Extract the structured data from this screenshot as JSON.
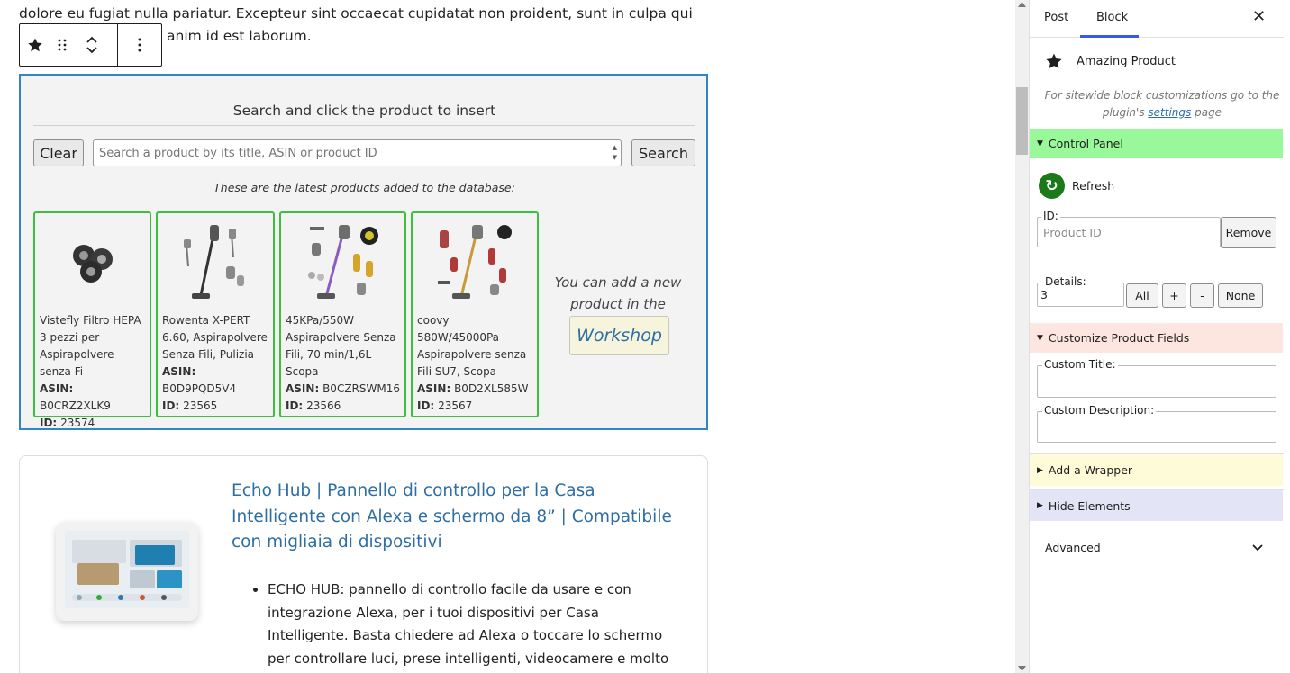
{
  "editor": {
    "paragraph_line1": "dolore eu fugiat nulla pariatur. Excepteur sint occaecat cupidatat non proident, sunt in culpa qui",
    "paragraph_line2": "anim id est laborum.",
    "block_box": {
      "title": "Search and click the product to insert",
      "clear_label": "Clear",
      "search_placeholder": "Search a product by its title, ASIN or product ID",
      "search_label": "Search",
      "latest_note": "These are the latest products added to the database:",
      "products": [
        {
          "title": "Vistefly Filtro HEPA 3 pezzi per Aspirapolvere senza Fi",
          "asin_label": "ASIN:",
          "asin": "B0CRZ2XLK9",
          "id_label": "ID:",
          "id": "23574",
          "image": "hepa-filters-icon"
        },
        {
          "title": "Rowenta X-PERT 6.60, Aspirapolvere Senza Fili, Pulizia",
          "asin_label": "ASIN:",
          "asin": "B0D9PQD5V4",
          "id_label": "ID:",
          "id": "23565",
          "image": "stick-vacuum-icon"
        },
        {
          "title": "45KPa/550W Aspirapolvere Senza Fili, 70 min/1,6L Scopa",
          "asin_label": "ASIN:",
          "asin": "B0CZRSWM16",
          "id_label": "ID:",
          "id": "23566",
          "image": "stick-vacuum-kit-icon"
        },
        {
          "title": "coovy 580W/45000Pa Aspirapolvere senza Fili SU7, Scopa",
          "asin_label": "ASIN:",
          "asin": "B0D2XL585W",
          "id_label": "ID:",
          "id": "23567",
          "image": "stick-vacuum-kit-icon"
        }
      ],
      "add_note": "You can add a new product in the",
      "workshop_label": "Workshop"
    },
    "product": {
      "title": "Echo Hub | Pannello di controllo per la Casa Intelligente con Alexa e schermo da 8” | Compatibile con migliaia di dispositivi",
      "bullet": "ECHO HUB: pannello di controllo facile da usare e con integrazione Alexa, per i tuoi dispositivi per Casa Intelligente. Basta chiedere ad Alexa o toccare lo schermo per controllare luci, prese intelligenti, videocamere e molto altro."
    }
  },
  "sidebar": {
    "tabs": [
      "Post",
      "Block"
    ],
    "active_tab": "Block",
    "close_label": "✕",
    "block_name": "Amazing Product",
    "info_prefix": "For sitewide block customizations go to the plugin's",
    "info_link": "settings",
    "info_suffix": "page",
    "control_panel": {
      "label": "Control Panel",
      "color": "#99f899",
      "refresh_label": "Refresh",
      "id_label": "ID:",
      "id_placeholder": "Product ID",
      "remove_label": "Remove",
      "details_label": "Details:",
      "details_value": "3",
      "details_buttons": [
        "All",
        "+",
        "-",
        "None"
      ]
    },
    "customize": {
      "label": "Customize Product Fields",
      "color": "#fde6e0",
      "custom_title_label": "Custom Title:",
      "custom_description_label": "Custom Description:"
    },
    "wrapper": {
      "label": "Add a Wrapper",
      "color": "#fefbd8"
    },
    "hide": {
      "label": "Hide Elements",
      "color": "#e3e4f6"
    },
    "advanced_label": "Advanced"
  }
}
